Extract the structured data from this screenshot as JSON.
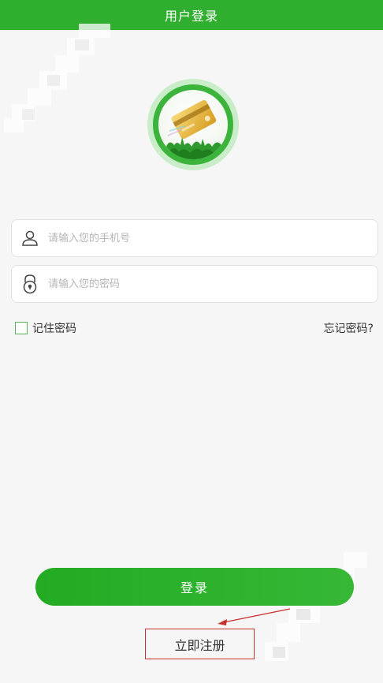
{
  "header": {
    "title": "用户登录"
  },
  "login_form": {
    "phone_placeholder": "请输入您的手机号",
    "password_placeholder": "请输入您的密码",
    "remember_label": "记住密码",
    "forgot_label": "忘记密码?"
  },
  "actions": {
    "login_label": "登录",
    "register_label": "立即注册"
  },
  "icons": {
    "user": "user-icon",
    "lock": "lock-icon",
    "logo": "card-logo-icon"
  },
  "colors": {
    "primary": "#2fae2f",
    "annotation": "#c9302c",
    "background": "#f6f6f6"
  }
}
